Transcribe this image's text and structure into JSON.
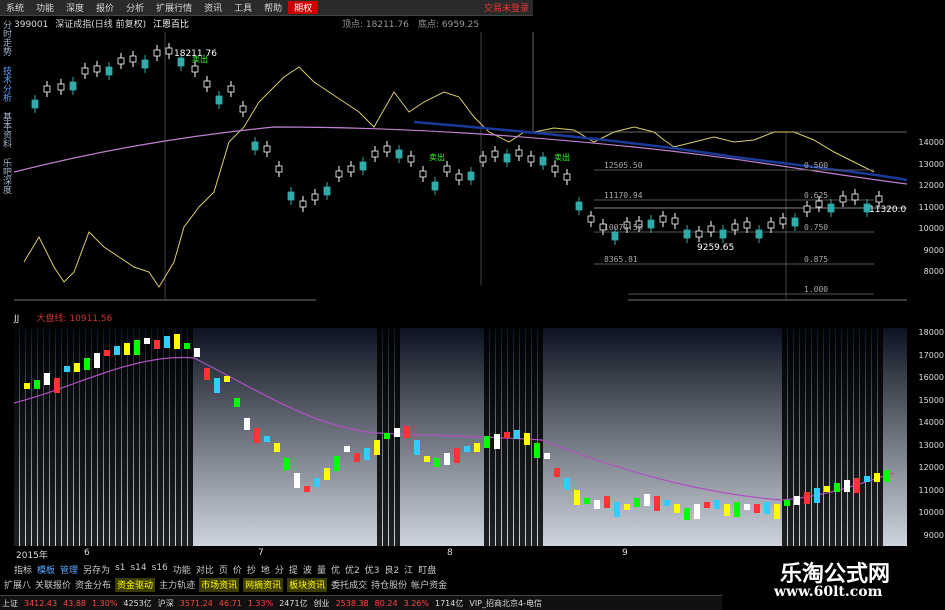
{
  "menu": {
    "items": [
      "系统",
      "功能",
      "深度",
      "报价",
      "分析",
      "扩展行情",
      "资讯",
      "工具",
      "帮助"
    ],
    "active": "期权",
    "status": "交易未登录"
  },
  "title": {
    "code": "399001",
    "name": "深证成指(日线 前复权)",
    "ref": "江恩百比",
    "top_label": "顶点: 18211.76",
    "bottom_label": "底点: 6959.25"
  },
  "side_tabs": [
    "分时走势",
    "技术分析",
    "基本资料",
    "乐吧深度"
  ],
  "upper_axis": [
    "14000",
    "13000",
    "12000",
    "11000",
    "10000",
    "9000",
    "8000"
  ],
  "annotations": {
    "peak": "18211.76",
    "sell_signal": "卖出",
    "right_price": "11320.0",
    "low": "9259.65"
  },
  "fib_levels": [
    {
      "price": "12505.50",
      "ratio": "0.500"
    },
    {
      "price": "11170.94",
      "ratio": "0.625"
    },
    {
      "price": "10077.59",
      "ratio": "0.750"
    },
    {
      "price": "8365.81",
      "ratio": "0.875"
    },
    {
      "price": "",
      "ratio": "1.000"
    }
  ],
  "jj": {
    "label": "JJ",
    "key": "大盘线:",
    "value": "10911.56"
  },
  "lower_axis": [
    "18000",
    "17000",
    "16000",
    "15000",
    "14000",
    "13000",
    "12000",
    "11000",
    "10000",
    "9000"
  ],
  "date_bar": {
    "year": "2015年",
    "months": [
      "6",
      "7",
      "8",
      "9"
    ]
  },
  "toolbar_row1": [
    "指标",
    "模板",
    "管理",
    "另存为",
    "s1",
    "s14",
    "s16",
    "功能",
    "对比",
    "页",
    "价",
    "抄",
    "地",
    "分",
    "提",
    "波",
    "量",
    "优",
    "优2",
    "优3",
    "良2",
    "江",
    "盯盘"
  ],
  "toolbar_row1_on": [
    "模板",
    "管理"
  ],
  "toolbar_row2": [
    "扩展八",
    "关联报价",
    "资金分布",
    "资金驱动",
    "主力轨迹",
    "市场资讯",
    "网摘资讯",
    "板块资讯",
    "委托成交",
    "持仓股份",
    "帐户资金"
  ],
  "toolbar_row2_hl": [
    "资金驱动",
    "市场资讯",
    "网摘资讯",
    "板块资讯"
  ],
  "statusbar": [
    {
      "text": "上证",
      "c": "g"
    },
    {
      "text": "3412.43",
      "c": "r"
    },
    {
      "text": "43.88",
      "c": "r"
    },
    {
      "text": "1.30%",
      "c": "r"
    },
    {
      "text": "4253亿",
      "c": "g"
    },
    {
      "text": "沪深",
      "c": "g"
    },
    {
      "text": "3571.24",
      "c": "r"
    },
    {
      "text": "46.71",
      "c": "r"
    },
    {
      "text": "1.33%",
      "c": "r"
    },
    {
      "text": "2471亿",
      "c": "g"
    },
    {
      "text": "创业",
      "c": "g"
    },
    {
      "text": "2538.38",
      "c": "r"
    },
    {
      "text": "80.24",
      "c": "r"
    },
    {
      "text": "3.26%",
      "c": "r"
    },
    {
      "text": "1714亿",
      "c": "g"
    },
    {
      "text": "VIP_招商北京4-电信",
      "c": "g"
    }
  ],
  "watermark": {
    "line1": "乐淘公式网",
    "line2": "www.60lt.com"
  }
}
